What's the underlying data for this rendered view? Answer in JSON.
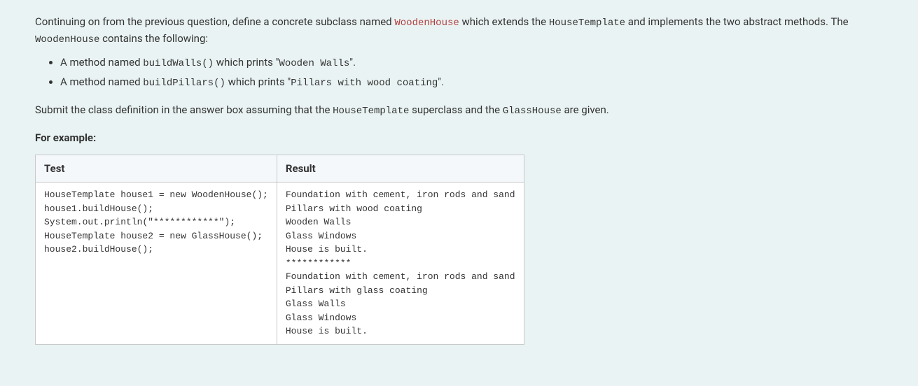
{
  "intro": {
    "segments": [
      {
        "text": "Continuing on from the previous question, define a concrete subclass named ",
        "cls": ""
      },
      {
        "text": "WoodenHouse",
        "cls": "code-inline code-red"
      },
      {
        "text": " which extends the ",
        "cls": ""
      },
      {
        "text": "HouseTemplate",
        "cls": "code-inline"
      },
      {
        "text": " and implements the two abstract methods. The ",
        "cls": ""
      },
      {
        "text": "WoodenHouse",
        "cls": "code-inline"
      },
      {
        "text": " contains the following:",
        "cls": ""
      }
    ]
  },
  "bullets": [
    {
      "segments": [
        {
          "text": "A method named ",
          "cls": ""
        },
        {
          "text": "buildWalls()",
          "cls": "code-inline"
        },
        {
          "text": " which prints \"",
          "cls": ""
        },
        {
          "text": "Wooden Walls",
          "cls": "code-inline"
        },
        {
          "text": "\".",
          "cls": ""
        }
      ]
    },
    {
      "segments": [
        {
          "text": "A method named ",
          "cls": ""
        },
        {
          "text": "buildPillars()",
          "cls": "code-inline"
        },
        {
          "text": " which prints \"",
          "cls": ""
        },
        {
          "text": "Pillars with wood coating",
          "cls": "code-inline"
        },
        {
          "text": "\".",
          "cls": ""
        }
      ]
    }
  ],
  "submit": {
    "segments": [
      {
        "text": "Submit the class definition in the answer box assuming that the ",
        "cls": ""
      },
      {
        "text": "HouseTemplate",
        "cls": "code-inline"
      },
      {
        "text": " superclass and the ",
        "cls": ""
      },
      {
        "text": "GlassHouse",
        "cls": "code-inline"
      },
      {
        "text": " are given.",
        "cls": ""
      }
    ]
  },
  "example_label": "For example:",
  "table": {
    "headers": [
      "Test",
      "Result"
    ],
    "rows": [
      {
        "test": "HouseTemplate house1 = new WoodenHouse();\nhouse1.buildHouse();\nSystem.out.println(\"************\");\nHouseTemplate house2 = new GlassHouse();\nhouse2.buildHouse();",
        "result": "Foundation with cement, iron rods and sand\nPillars with wood coating\nWooden Walls\nGlass Windows\nHouse is built.\n************\nFoundation with cement, iron rods and sand\nPillars with glass coating\nGlass Walls\nGlass Windows\nHouse is built."
      }
    ]
  }
}
